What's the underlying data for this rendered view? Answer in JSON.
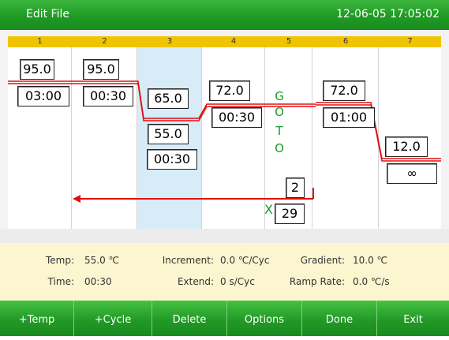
{
  "window": {
    "title": "Edit File",
    "datetime": "12-06-05 17:05:02"
  },
  "columns": [
    "1",
    "2",
    "3",
    "4",
    "5",
    "6",
    "7"
  ],
  "steps": {
    "s1": {
      "temp": "95.0",
      "time": "03:00"
    },
    "s2": {
      "temp": "95.0",
      "time": "00:30"
    },
    "s3": {
      "temp_a": "65.0",
      "temp_b": "55.0",
      "time": "00:30"
    },
    "s4": {
      "temp": "72.0",
      "time": "00:30"
    },
    "s5": {
      "goto_letters": [
        "G",
        "O",
        "T",
        "O"
      ],
      "goto_step": "2",
      "times_symbol": "X",
      "cycles": "29"
    },
    "s6": {
      "temp": "72.0",
      "time": "01:00"
    },
    "s7": {
      "temp": "12.0",
      "time": "∞"
    }
  },
  "info": {
    "temp_label": "Temp:",
    "temp_value": "55.0 ℃",
    "time_label": "Time:",
    "time_value": "00:30",
    "increment_label": "Increment:",
    "increment_value": "0.0 ℃/Cyc",
    "extend_label": "Extend:",
    "extend_value": "0 s/Cyc",
    "gradient_label": "Gradient:",
    "gradient_value": "10.0 ℃",
    "ramp_label": "Ramp Rate:",
    "ramp_value": "0.0 ℃/s"
  },
  "toolbar": {
    "temp_label": "+Temp",
    "cycle_label": "+Cycle",
    "delete_label": "Delete",
    "options_label": "Options",
    "done_label": "Done",
    "exit_label": "Exit"
  },
  "colors": {
    "accent_green": "#229a27",
    "header_yellow": "#f0c400",
    "line_red": "#e01010",
    "selection_blue": "#d8ecf8"
  }
}
